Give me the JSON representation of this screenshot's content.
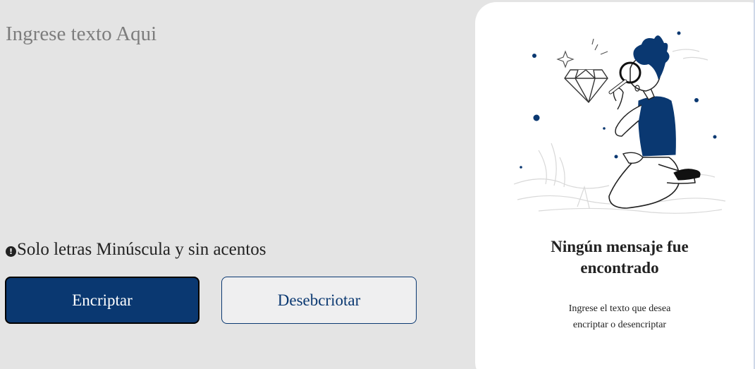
{
  "input": {
    "placeholder": "Ingrese texto Aqui",
    "value": ""
  },
  "hint": {
    "icon": "exclamation-circle-icon",
    "text": "Solo letras Minúscula y sin acentos"
  },
  "buttons": {
    "encrypt_label": "Encriptar",
    "decrypt_label": "Desebcriotar"
  },
  "output_panel": {
    "illustration": "person-with-magnifying-glass-and-diamond",
    "title_line1": "Ningún mensaje fue",
    "title_line2": "encontrado",
    "subtitle_line1": "Ingrese el texto que desea",
    "subtitle_line2": "encriptar o desencriptar"
  },
  "colors": {
    "background": "#e4e4e4",
    "primary": "#0a3871",
    "secondary_button_bg": "#efeff0",
    "panel_bg": "#ffffff"
  }
}
